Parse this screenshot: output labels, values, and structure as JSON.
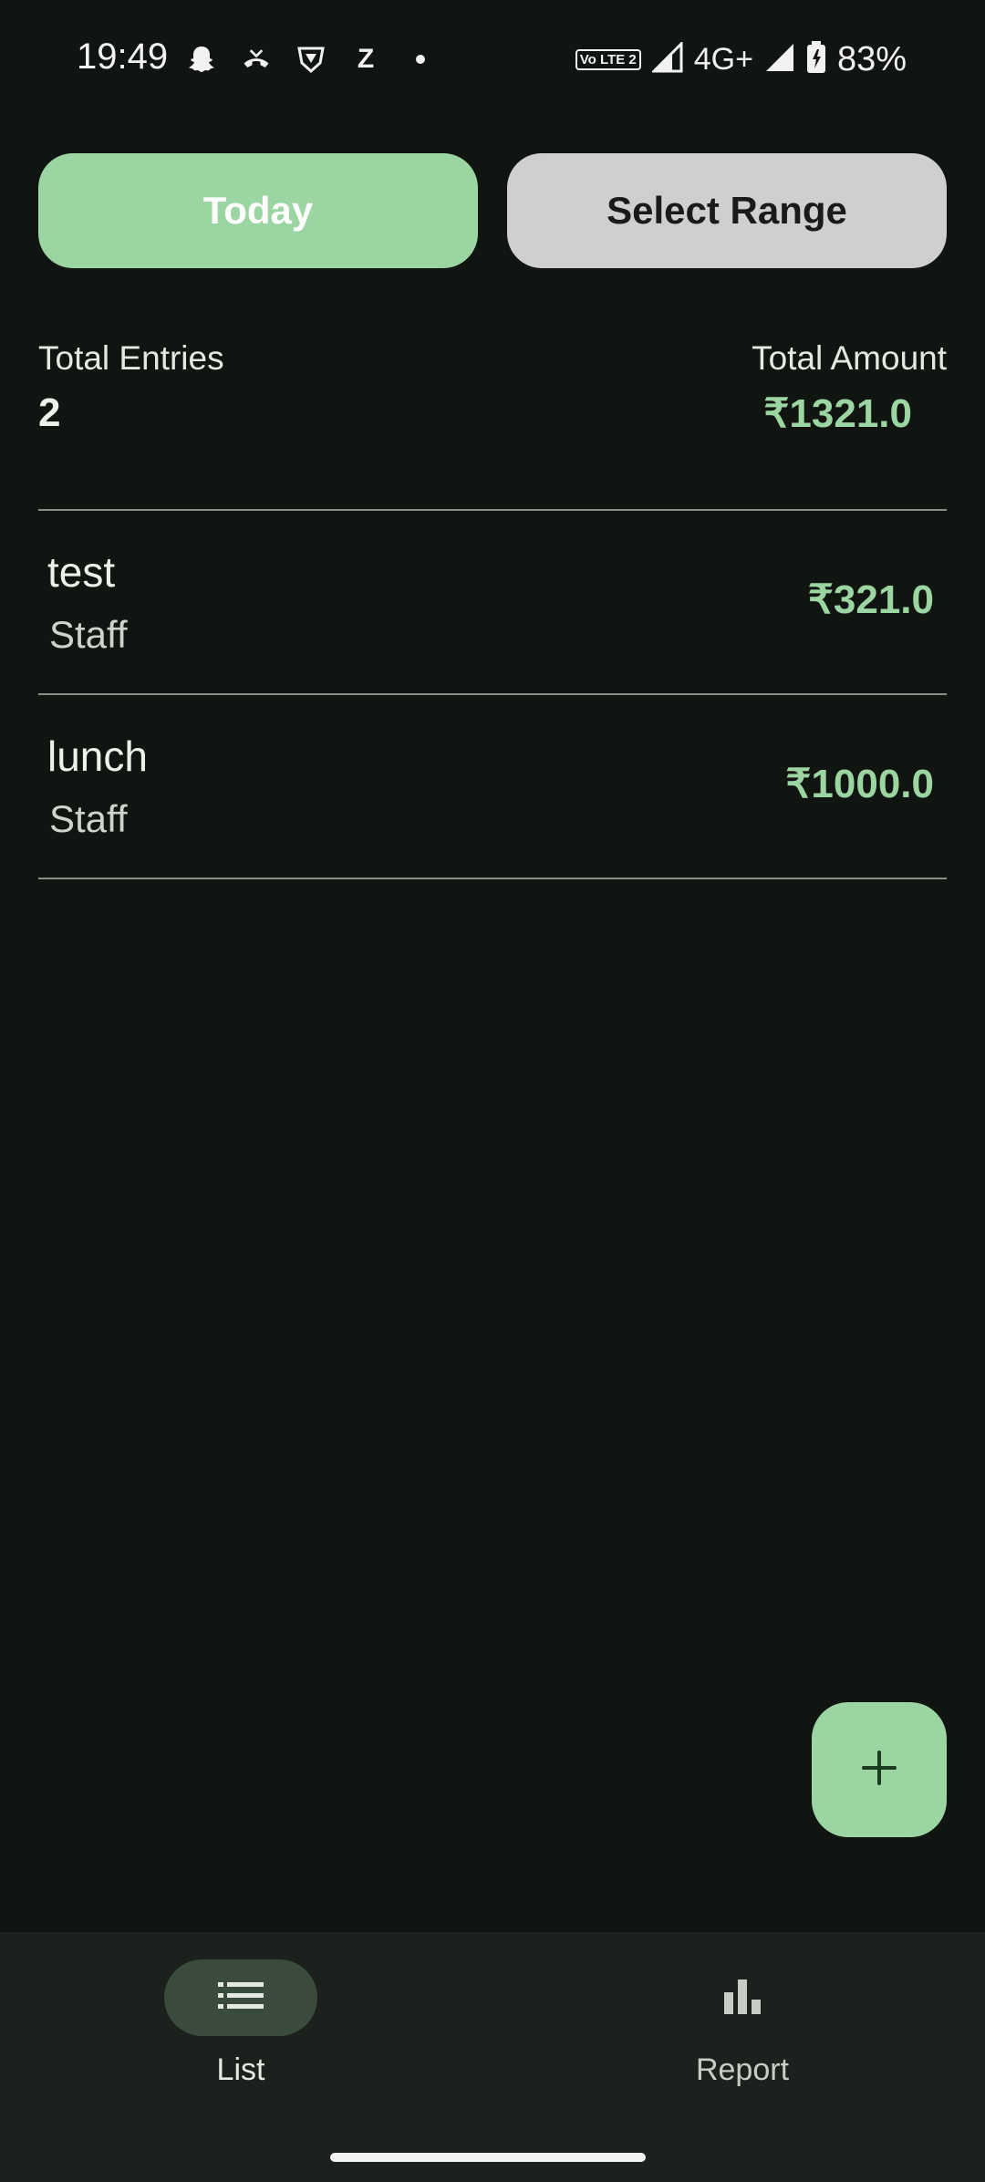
{
  "status_bar": {
    "time": "19:49",
    "left_icons": [
      "snapchat-icon",
      "missed-call-icon",
      "vpn-shield-icon",
      "z-app-icon",
      "dot-icon"
    ],
    "z_glyph": "Z",
    "volte": "Vo LTE 2",
    "network": "4G+",
    "battery": "83%"
  },
  "filters": {
    "today_label": "Today",
    "range_label": "Select Range"
  },
  "summary": {
    "entries_label": "Total Entries",
    "entries_value": "2",
    "amount_label": "Total Amount",
    "amount_value": "₹1321.0"
  },
  "entries": [
    {
      "title": "test",
      "category": "Staff",
      "amount": "₹321.0"
    },
    {
      "title": "lunch",
      "category": "Staff",
      "amount": "₹1000.0"
    }
  ],
  "fab": {
    "icon": "plus-icon"
  },
  "nav": {
    "items": [
      {
        "label": "List",
        "icon": "list-icon",
        "active": true
      },
      {
        "label": "Report",
        "icon": "bar-chart-icon",
        "active": false
      }
    ]
  },
  "colors": {
    "background": "#111512",
    "accent": "#9bd5a1",
    "secondary_button": "#cfcfcf",
    "nav_background": "#1d211e",
    "active_pill": "#3a4a3c"
  }
}
